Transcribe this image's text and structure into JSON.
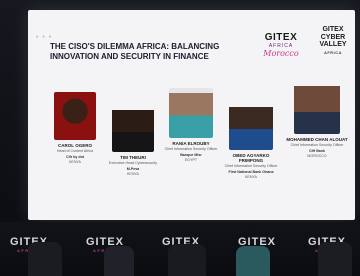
{
  "slide": {
    "dots": "• • •",
    "title": "THE CISO'S DILEMMA AFRICA: BALANCING INNOVATION AND SECURITY IN FINANCE",
    "logo_gitex_africa": {
      "main": "GITEX",
      "sub": "AFRICA",
      "script": "Morocco"
    },
    "logo_cyber": {
      "line1": "GITEX",
      "line2": "CYBER",
      "line3": "VALLEY",
      "sub": "AFRICA"
    }
  },
  "speakers": [
    {
      "name": "CAROL OGERO",
      "role": "Head of Content Africa",
      "org_line": "Cifr by dot",
      "org": "KENYA"
    },
    {
      "name": "TIM THEURI",
      "role": "Executive Head Cybersecurity",
      "org_line": "M-Pesa",
      "org": "KENYA"
    },
    {
      "name": "RANIA ELROUBY",
      "role": "Chief Information Security Officer",
      "org_line": "Banque Misr",
      "org": "EGYPT"
    },
    {
      "name": "OBED AGYARKO FRIMPONG",
      "role": "Chief Information Security Officer",
      "org_line": "First National Bank Ghana",
      "org": "KENYA"
    },
    {
      "name": "MOHAMMED CHAN ALOUAT",
      "role": "Chief Information Security Officer",
      "org_line": "CIH Bank",
      "org": "MOROCCO"
    }
  ],
  "stage": {
    "logos": [
      {
        "main": "GITEX",
        "sub": "AFRICA"
      },
      {
        "main": "GITEX",
        "sub": "AFRICA"
      },
      {
        "main": "GITEX",
        "sub": "AFRICA"
      },
      {
        "main": "GITEX",
        "sub": "AFRICA"
      },
      {
        "main": "GITEX",
        "sub": "AFRICA"
      }
    ]
  },
  "colors": {
    "accent": "#c43b8a",
    "screen": "#f4f3f6",
    "dark": "#0a0b0f"
  }
}
